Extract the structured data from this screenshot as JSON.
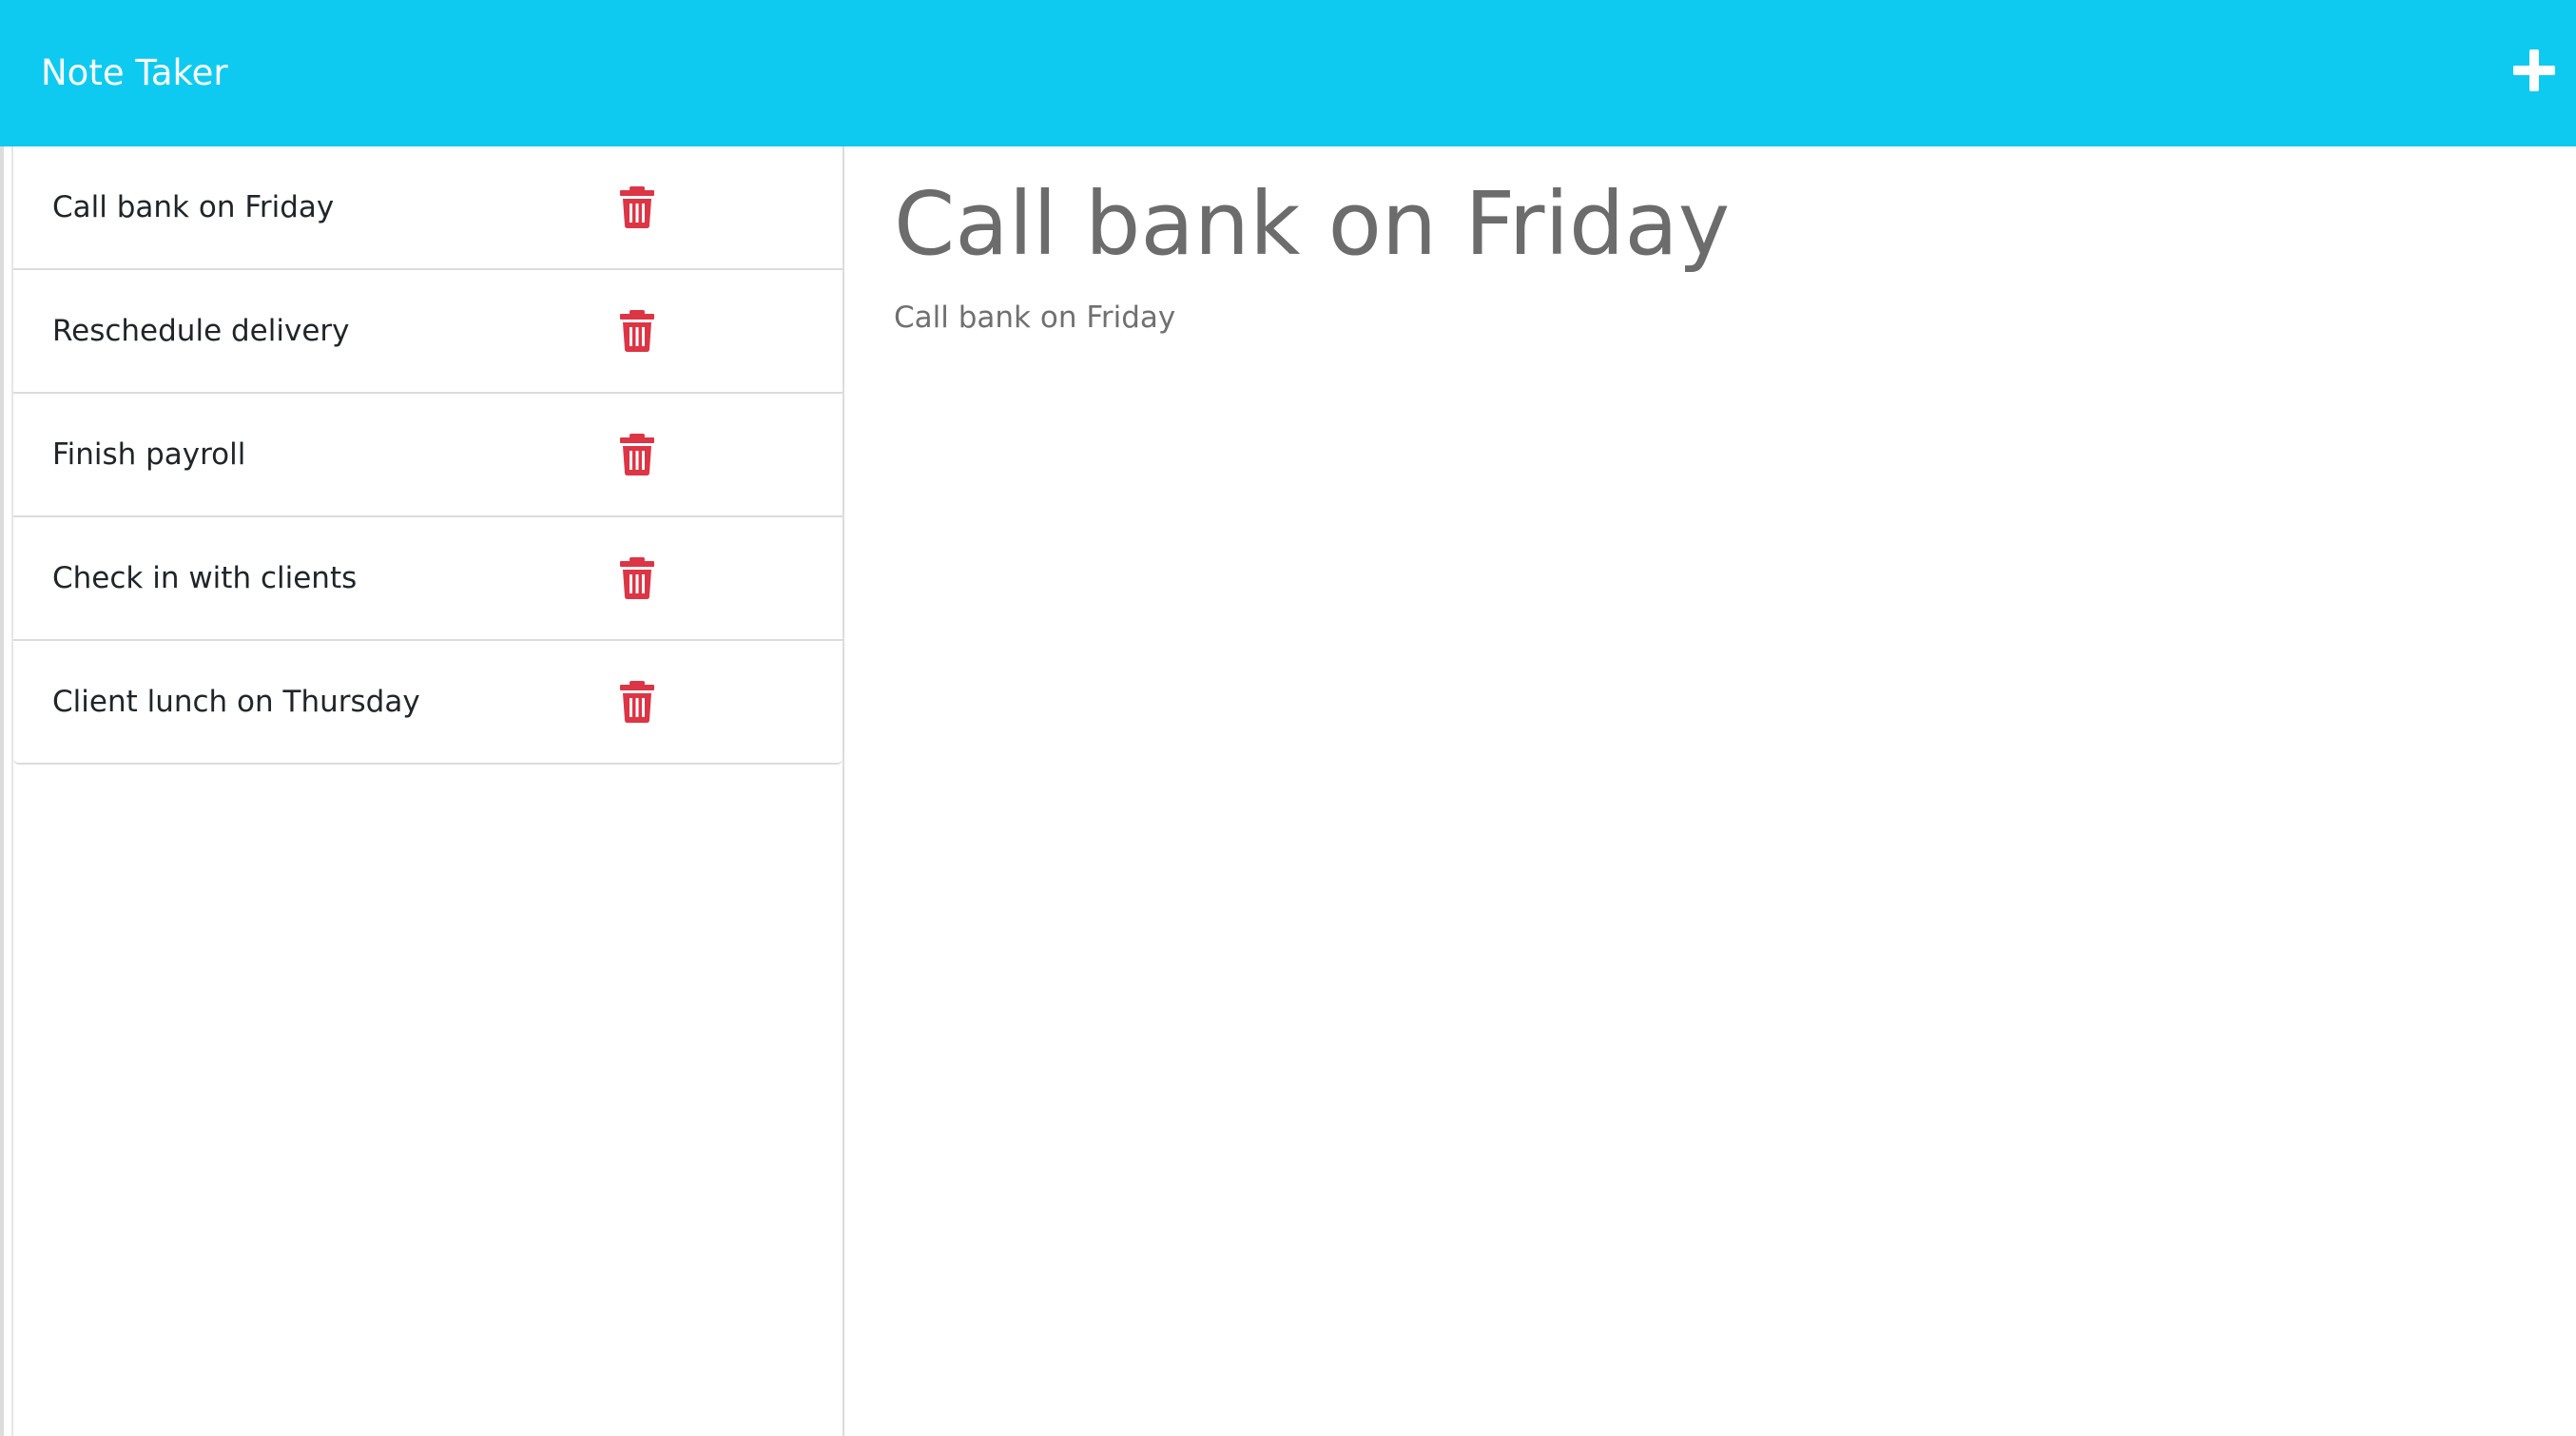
{
  "navbar": {
    "title": "Note Taker",
    "new_note_icon": "plus-icon",
    "background_color": "#0fcaf0"
  },
  "sidebar": {
    "notes": [
      {
        "title": "Call bank on Friday",
        "delete_icon": "trash-icon"
      },
      {
        "title": "Reschedule delivery",
        "delete_icon": "trash-icon"
      },
      {
        "title": "Finish payroll",
        "delete_icon": "trash-icon"
      },
      {
        "title": "Check in with clients",
        "delete_icon": "trash-icon"
      },
      {
        "title": "Client lunch on Thursday",
        "delete_icon": "trash-icon"
      }
    ],
    "delete_icon_color": "#dc3545"
  },
  "main": {
    "note_title": "Call bank on Friday",
    "note_text": "Call bank on Friday"
  }
}
